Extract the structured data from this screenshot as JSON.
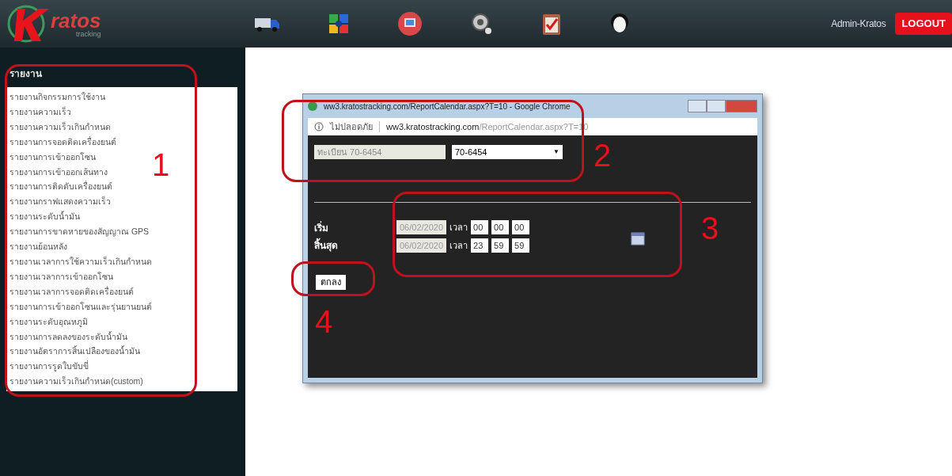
{
  "header": {
    "logo": {
      "name": "ratos",
      "tagline": "tracking"
    },
    "user": "Admin-Kratos",
    "logout": "LOGOUT"
  },
  "sidebar": {
    "title": "รายงาน",
    "items": [
      {
        "label": "รายงานกิจกรรมการใช้งาน"
      },
      {
        "label": "รายงานความเร็ว"
      },
      {
        "label": "รายงานความเร็วเกินกำหนด"
      },
      {
        "label": "รายงานการจอดติดเครื่องยนต์"
      },
      {
        "label": "รายงานการเข้าออกโซน"
      },
      {
        "label": "รายงานการเข้าออกเส้นทาง"
      },
      {
        "label": "รายงานการติดดับเครื่องยนต์"
      },
      {
        "label": "รายงานกราฟแสดงความเร็ว"
      },
      {
        "label": "รายงานระดับน้ำมัน"
      },
      {
        "label": "รายงานการขาดหายของสัญญาณ GPS"
      },
      {
        "label": "รายงานย้อนหลัง"
      },
      {
        "label": "รายงานเวลาการใช้ความเร็วเกินกำหนด"
      },
      {
        "label": "รายงานเวลาการเข้าออกโซน"
      },
      {
        "label": "รายงานเวลาการจอดติดเครื่องยนต์"
      },
      {
        "label": "รายงานการเข้าออกโซนและรุ่นยานยนต์"
      },
      {
        "label": "รายงานระดับอุณหภูมิ"
      },
      {
        "label": "รายงานการลดลงของระดับน้ำมัน"
      },
      {
        "label": "รายงานอัตราการสิ้นเปลืองของน้ำมัน"
      },
      {
        "label": "รายงานการรูดใบขับขี่"
      },
      {
        "label": "รายงานความเร็วเกินกำหนด(custom)"
      }
    ]
  },
  "popup": {
    "title": "ww3.kratostracking.com/ReportCalendar.aspx?T=10 - Google Chrome",
    "security": "ไม่ปลอดภัย",
    "url_host": "ww3.kratostracking.com",
    "url_path": "/ReportCalendar.aspx?T=10",
    "plate": "ทะเบียน 70-6454",
    "vehicle": "70-6454",
    "dropdown_caret": "▼",
    "ranges": [
      {
        "label": "เริ่ม",
        "date": "06/02/2020",
        "time_label": "เวลา",
        "hh": "00",
        "mm": "00",
        "ss": "00"
      },
      {
        "label": "สิ้นสุด",
        "date": "06/02/2020",
        "time_label": "เวลา",
        "hh": "23",
        "mm": "59",
        "ss": "59"
      }
    ],
    "submit": "ตกลง"
  },
  "annotations": [
    {
      "label": "1"
    },
    {
      "label": "2"
    },
    {
      "label": "3"
    },
    {
      "label": "4"
    }
  ]
}
